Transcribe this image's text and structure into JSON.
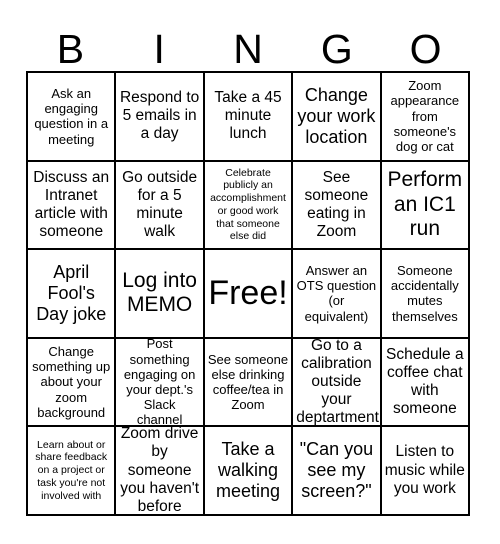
{
  "header": {
    "letters": [
      "B",
      "I",
      "N",
      "G",
      "O"
    ]
  },
  "grid": {
    "rows": [
      [
        {
          "text": "Ask an engaging question in a meeting",
          "size": "sm"
        },
        {
          "text": "Respond to 5 emails in a day",
          "size": "md"
        },
        {
          "text": "Take a 45 minute lunch",
          "size": "md"
        },
        {
          "text": "Change your work location",
          "size": "lg"
        },
        {
          "text": "Zoom appearance from someone's dog or cat",
          "size": "sm"
        }
      ],
      [
        {
          "text": "Discuss an Intranet article with someone",
          "size": "md"
        },
        {
          "text": "Go outside for a 5 minute walk",
          "size": "md"
        },
        {
          "text": "Celebrate publicly an accomplishment or good work that someone else did",
          "size": "xs"
        },
        {
          "text": "See someone eating in Zoom",
          "size": "md"
        },
        {
          "text": "Perform an IC1 run",
          "size": "xl"
        }
      ],
      [
        {
          "text": "April Fool's Day joke",
          "size": "lg"
        },
        {
          "text": "Log into MEMO",
          "size": "xl"
        },
        {
          "text": "Free!",
          "size": "free"
        },
        {
          "text": "Answer an OTS question (or equivalent)",
          "size": "sm"
        },
        {
          "text": "Someone accidentally mutes themselves",
          "size": "sm"
        }
      ],
      [
        {
          "text": "Change something up about your zoom background",
          "size": "sm"
        },
        {
          "text": "Post something engaging on your dept.'s Slack channel",
          "size": "sm"
        },
        {
          "text": "See someone else drinking coffee/tea in Zoom",
          "size": "sm"
        },
        {
          "text": "Go to a calibration outside your deptartment",
          "size": "md"
        },
        {
          "text": "Schedule a coffee chat with someone",
          "size": "md"
        }
      ],
      [
        {
          "text": "Learn about or share feedback on a project or task you're not involved with",
          "size": "xs"
        },
        {
          "text": "Zoom drive by someone you haven't before",
          "size": "md"
        },
        {
          "text": "Take a walking meeting",
          "size": "lg"
        },
        {
          "text": "\"Can you see my screen?\"",
          "size": "lg"
        },
        {
          "text": "Listen to music while you work",
          "size": "md"
        }
      ]
    ]
  },
  "colors": {
    "background": "#ffffff",
    "text": "#000000",
    "border": "#000000"
  }
}
